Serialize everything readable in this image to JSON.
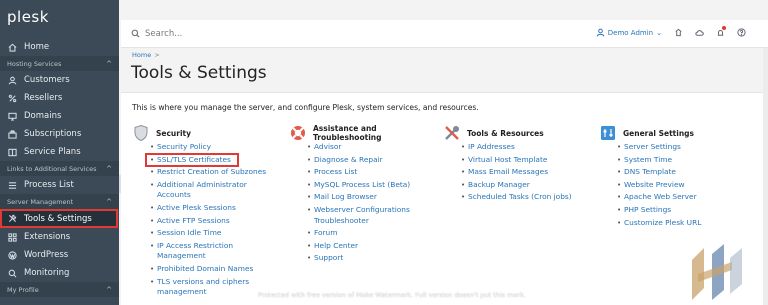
{
  "app": {
    "logo": "plesk"
  },
  "sidebar": {
    "home": "Home",
    "sections": [
      {
        "label": "Hosting Services",
        "items": [
          "Customers",
          "Resellers",
          "Domains",
          "Subscriptions",
          "Service Plans"
        ]
      },
      {
        "label": "Links to Additional Services",
        "items": [
          "Process List"
        ]
      },
      {
        "label": "Server Management",
        "items": [
          "Tools & Settings",
          "Extensions",
          "WordPress",
          "Monitoring"
        ]
      },
      {
        "label": "My Profile",
        "items": []
      }
    ],
    "active_item": "Tools & Settings",
    "collapse_glyph": "‹",
    "chevron": "^"
  },
  "topbar": {
    "search_placeholder": "Search...",
    "user_label": "Demo Admin",
    "user_chevron": "⌄",
    "icons": [
      "user-icon",
      "lifebuoy-icon",
      "cloud-icon",
      "notifications-icon",
      "help-icon"
    ]
  },
  "header": {
    "breadcrumb": "Home",
    "breadcrumb_sep": ">",
    "title": "Tools & Settings"
  },
  "main": {
    "intro": "This is where you manage the server, and configure Plesk, system services, and resources.",
    "columns": [
      {
        "title": "Security",
        "icon": "shield-icon",
        "links": [
          "Security Policy",
          "SSL/TLS Certificates",
          "Restrict Creation of Subzones",
          "Additional Administrator Accounts",
          "Active Plesk Sessions",
          "Active FTP Sessions",
          "Session Idle Time",
          "IP Access Restriction Management",
          "Prohibited Domain Names",
          "TLS versions and ciphers management"
        ],
        "highlighted": "SSL/TLS Certificates"
      },
      {
        "title": "Assistance and Troubleshooting",
        "icon": "lifebuoy-icon",
        "links": [
          "Advisor",
          "Diagnose & Repair",
          "Process List",
          "MySQL Process List (Beta)",
          "Mail Log Browser",
          "Webserver Configurations Troubleshooter",
          "Forum",
          "Help Center",
          "Support"
        ]
      },
      {
        "title": "Tools & Resources",
        "icon": "tools-icon",
        "links": [
          "IP Addresses",
          "Virtual Host Template",
          "Mass Email Messages",
          "Backup Manager",
          "Scheduled Tasks (Cron jobs)"
        ]
      },
      {
        "title": "General Settings",
        "icon": "settings-panel-icon",
        "links": [
          "Server Settings",
          "System Time",
          "DNS Template",
          "Website Preview",
          "Apache Web Server",
          "PHP Settings",
          "Customize Plesk URL"
        ]
      }
    ]
  },
  "watermark": "Protected with free version of Make Watermark. Full version doesn't put this mark.",
  "colors": {
    "sidebar": "#3b4a56",
    "link": "#2874b8",
    "highlight": "#e03a32"
  }
}
